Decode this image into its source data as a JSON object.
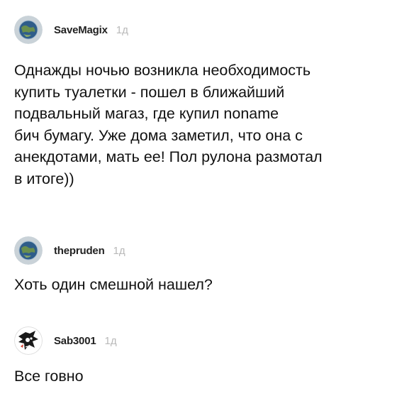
{
  "comments": [
    {
      "username": "SaveMagix",
      "time": "1д",
      "avatar_icon": "earth-globe-icon",
      "text": "Однажды ночью возникла необходимость\nкупить туалетки - пошел в ближайший\nподвальный магаз, где купил noname\nбич бумагу. Уже дома заметил, что она с\nанекдотами, мать ее! Пол рулона размотал\nв итоге))"
    },
    {
      "username": "thepruden",
      "time": "1д",
      "avatar_icon": "earth-globe-icon",
      "text": "Хоть один смешной нашел?"
    },
    {
      "username": "Sab3001",
      "time": "1д",
      "avatar_icon": "character-sketch-icon",
      "text": "Все говно"
    }
  ]
}
